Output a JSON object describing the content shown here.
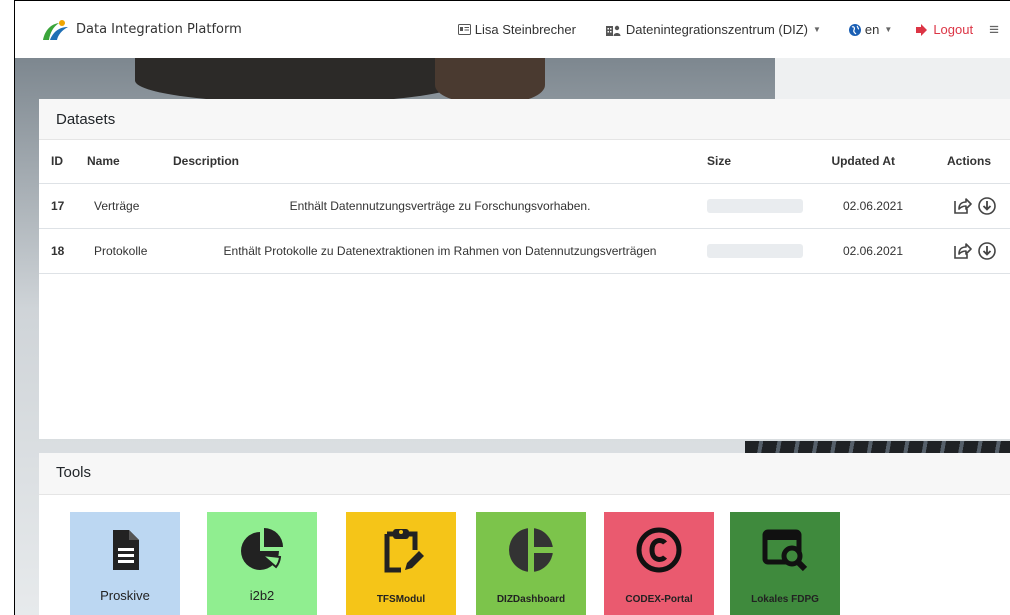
{
  "navbar": {
    "brand": "Data Integration Platform",
    "user": "Lisa Steinbrecher",
    "organization": "Datenintegrationszentrum (DIZ)",
    "language": "en",
    "logout": "Logout"
  },
  "datasets": {
    "title": "Datasets",
    "columns": {
      "id": "ID",
      "name": "Name",
      "description": "Description",
      "size": "Size",
      "updated": "Updated At",
      "actions": "Actions"
    },
    "rows": [
      {
        "id": "17",
        "name": "Verträge",
        "description": "Enthält Datennutzungsverträge zu Forschungsvorhaben.",
        "updated": "02.06.2021"
      },
      {
        "id": "18",
        "name": "Protokolle",
        "description": "Enthält Protokolle zu Datenextraktionen im Rahmen von Datennutzungsverträgen",
        "updated": "02.06.2021"
      }
    ]
  },
  "tools": {
    "title": "Tools",
    "items": [
      {
        "label": "Proskive",
        "color": "#bcd7f2",
        "icon": "document-icon"
      },
      {
        "label": "i2b2",
        "color": "#90ee90",
        "icon": "pie-chart-icon"
      },
      {
        "label": "TFSModul",
        "color": "#f5c518",
        "icon": "clipboard-pen-icon"
      },
      {
        "label": "DIZDashboard",
        "color": "#7cc44b",
        "icon": "dashboard-icon"
      },
      {
        "label": "CODEX-Portal",
        "color": "#ea5a6f",
        "icon": "copyright-icon"
      },
      {
        "label": "Lokales FDPG",
        "color": "#3f8a3d",
        "icon": "search-window-icon"
      }
    ]
  },
  "colors": {
    "logout": "#dc3545",
    "navbar_bg": "#ffffff",
    "card_header_bg": "#f7f7f7"
  }
}
